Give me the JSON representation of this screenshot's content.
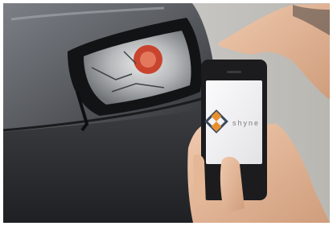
{
  "photo": {
    "description_icon": "phone-app-logo",
    "app_wordmark": "shyne",
    "colors": {
      "car_body": "#5a5d62",
      "phone_screen": "#f2f2f4",
      "logo_orange": "#e8902f",
      "logo_dark": "#3b4a5c"
    }
  }
}
